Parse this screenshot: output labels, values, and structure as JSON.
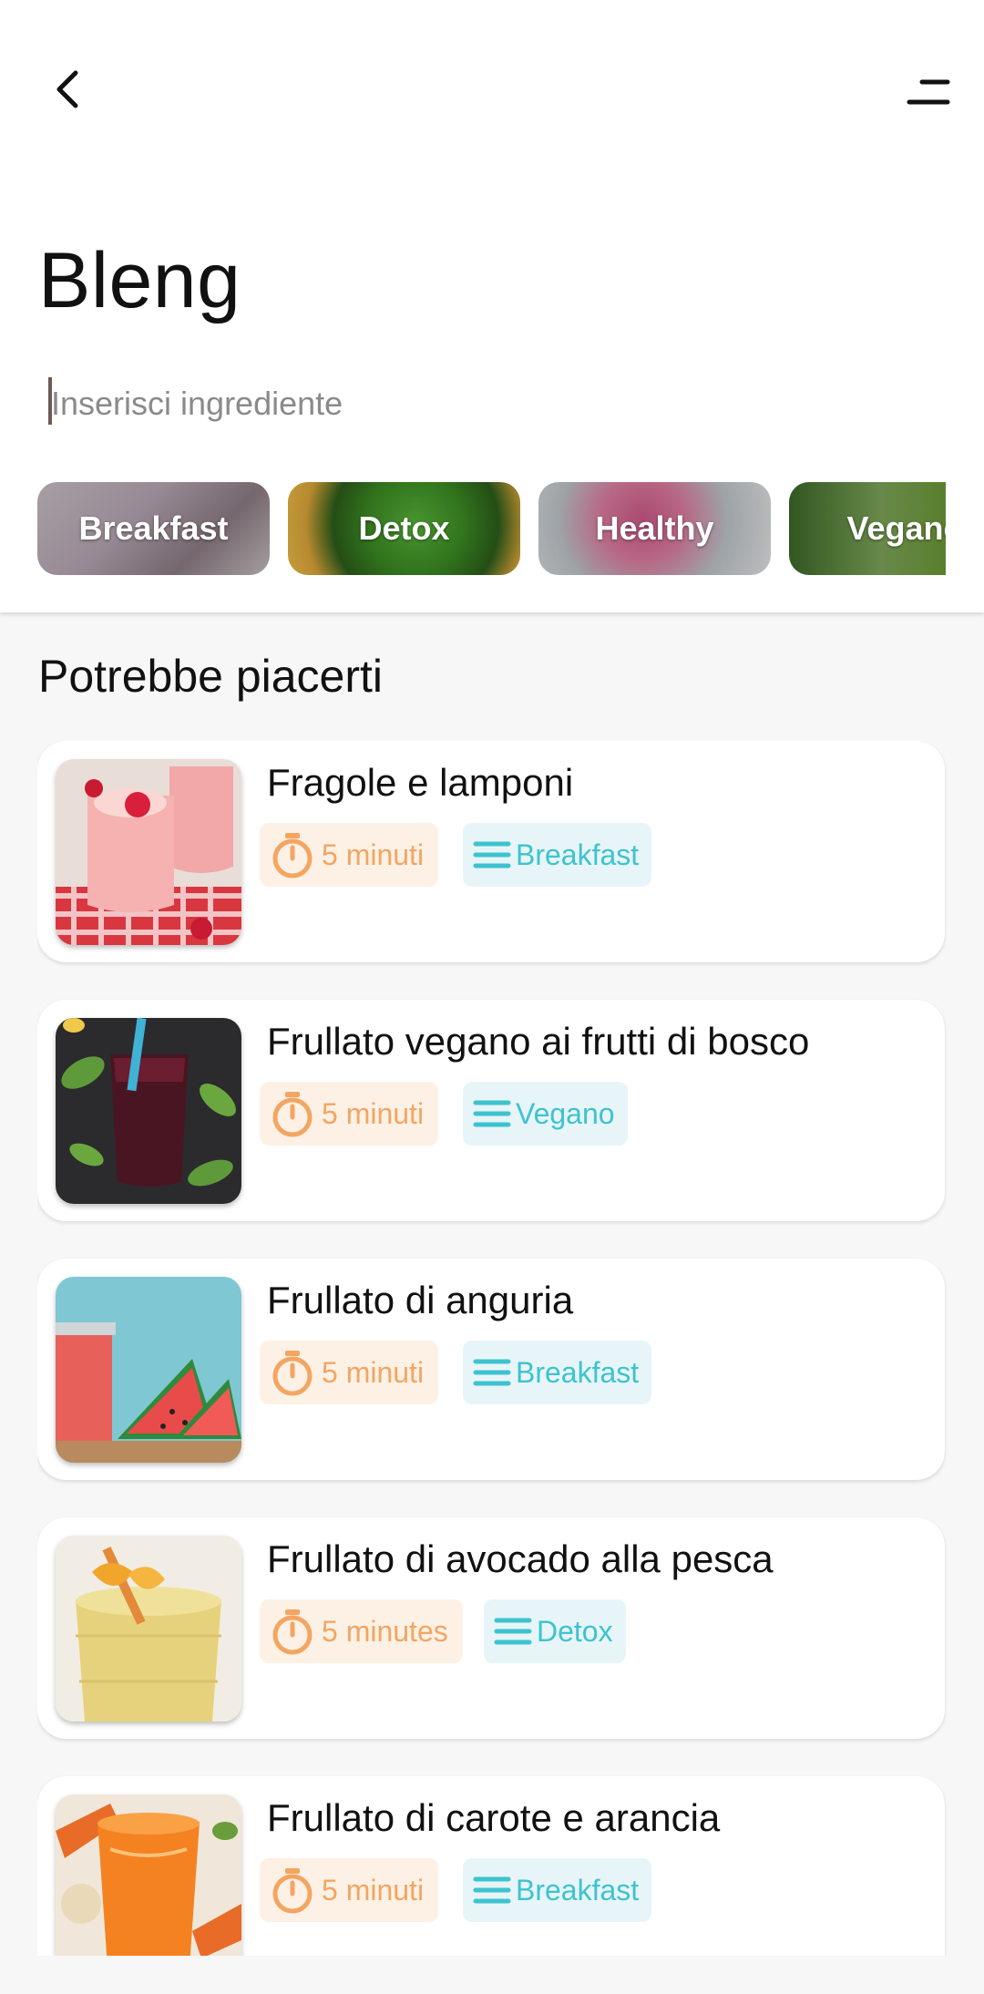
{
  "header": {
    "back_icon": "chevron-left-icon",
    "menu_icon": "menu-icon"
  },
  "app_title": "Bleng",
  "search": {
    "placeholder": "Inserisci ingrediente",
    "value": ""
  },
  "categories": [
    {
      "label": "Breakfast"
    },
    {
      "label": "Detox"
    },
    {
      "label": "Healthy"
    },
    {
      "label": "Vegano"
    }
  ],
  "section_title": "Potrebbe piacerti",
  "recipes": [
    {
      "title": "Fragole e lamponi",
      "time": "5 minuti",
      "category": "Breakfast"
    },
    {
      "title": "Frullato vegano ai frutti di bosco",
      "time": "5 minuti",
      "category": "Vegano"
    },
    {
      "title": "Frullato di anguria",
      "time": "5 minuti",
      "category": "Breakfast"
    },
    {
      "title": "Frullato di avocado alla pesca",
      "time": "5 minutes",
      "category": "Detox"
    },
    {
      "title": "Frullato di carote e arancia",
      "time": "5 minuti",
      "category": "Breakfast"
    }
  ],
  "colors": {
    "time_chip_text": "#f4a561",
    "time_chip_bg": "#fdf1e6",
    "category_chip_text": "#3dc3cf",
    "category_chip_bg": "#e7f5f8"
  }
}
